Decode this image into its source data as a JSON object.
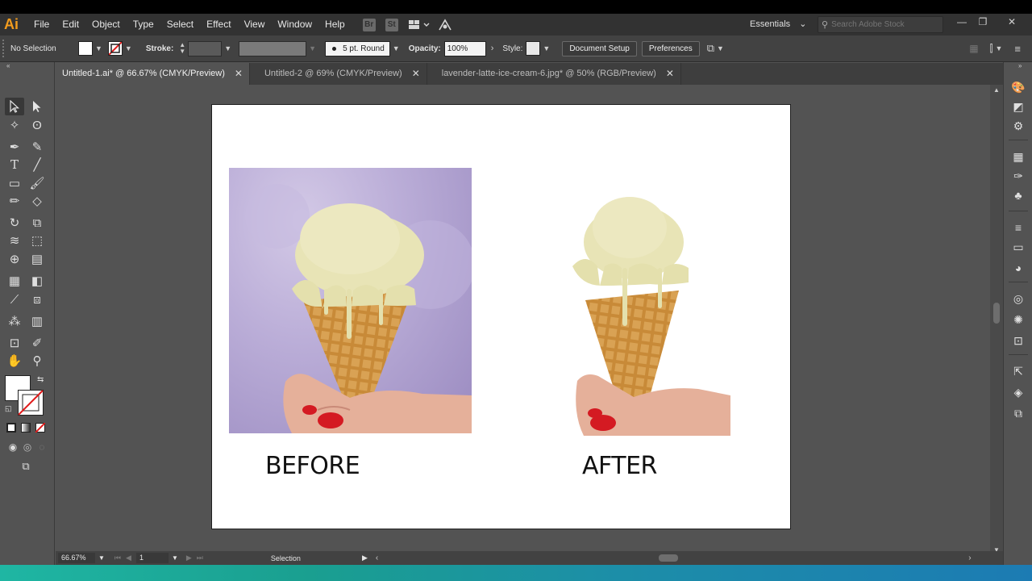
{
  "app": {
    "logo": "Ai"
  },
  "menu": [
    "File",
    "Edit",
    "Object",
    "Type",
    "Select",
    "Effect",
    "View",
    "Window",
    "Help"
  ],
  "menubar_icons": {
    "bridge": "Br",
    "stock": "St"
  },
  "workspace": {
    "label": "Essentials"
  },
  "search": {
    "placeholder": "Search Adobe Stock"
  },
  "control_bar": {
    "selection_status": "No Selection",
    "stroke_label": "Stroke:",
    "brush": "5 pt. Round",
    "opacity_label": "Opacity:",
    "opacity_value": "100%",
    "style_label": "Style:",
    "document_setup": "Document Setup",
    "preferences": "Preferences"
  },
  "tabs": [
    {
      "label": "Untitled-1.ai* @ 66.67% (CMYK/Preview)",
      "active": true
    },
    {
      "label": "Untitled-2 @ 69% (CMYK/Preview)",
      "active": false
    },
    {
      "label": "lavender-latte-ice-cream-6.jpg* @ 50% (RGB/Preview)",
      "active": false
    }
  ],
  "artboard": {
    "before_label": "BEFORE",
    "after_label": "AFTER"
  },
  "status_bar": {
    "zoom": "66.67%",
    "page": "1",
    "mode": "Selection"
  },
  "colors": {
    "accent": "#f29c1e",
    "lavender_bg": "#b5a8d6",
    "waffle": "#c98f3d",
    "ice_cream": "#e8e4b6",
    "nail_polish": "#d41a22"
  }
}
